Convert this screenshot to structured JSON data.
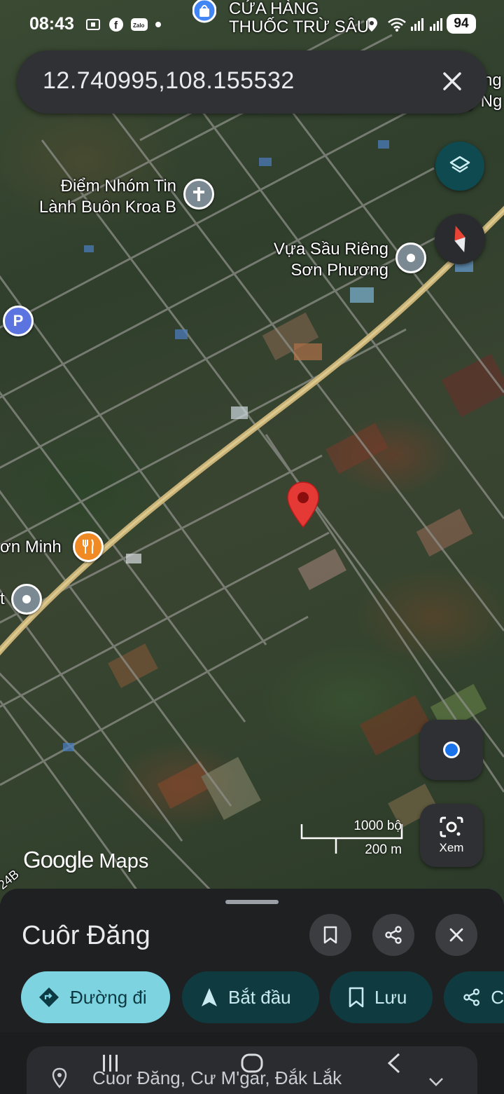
{
  "status_bar": {
    "time": "08:43",
    "battery": "94",
    "icons": [
      "screenshot-icon",
      "facebook-icon",
      "zalo-icon",
      "location-icon",
      "wifi-icon",
      "signal-icon"
    ]
  },
  "top_poi": {
    "label_line1": "CỬA HÀNG",
    "label_line2": "THUỐC TRỪ SÂU"
  },
  "search": {
    "query": "12.740995,108.155532"
  },
  "map": {
    "labels": {
      "diem_nhom_line1": "Điểm Nhóm Tin",
      "diem_nhom_line2": "Lành Buôn Kroa B",
      "vua_sau_rieng_line1": "Vựa Sầu Riêng",
      "vua_sau_rieng_line2": "Sơn Phương",
      "restaurant": "ơn Minh",
      "left_edge": "t",
      "right_edge_1": "ng",
      "right_edge_2": "y Ng",
      "road": "24B",
      "parking": "P"
    },
    "scale": {
      "imperial": "1000 bộ",
      "metric": "200 m"
    },
    "logo": {
      "google": "Google",
      "maps": "Maps"
    },
    "lens_label": "Xem"
  },
  "sheet": {
    "title": "Cuôr Đăng",
    "chips": {
      "directions": "Đường đi",
      "start": "Bắt đầu",
      "save": "Lưu",
      "share": "C"
    },
    "peek_address": "Cuor Đăng, Cư M'gar, Đắk Lắk"
  },
  "colors": {
    "accent_chip": "#7dd3e0",
    "dark_chip": "#0f3b40",
    "pin_red": "#e53935",
    "restaurant_orange": "#f08a24"
  }
}
